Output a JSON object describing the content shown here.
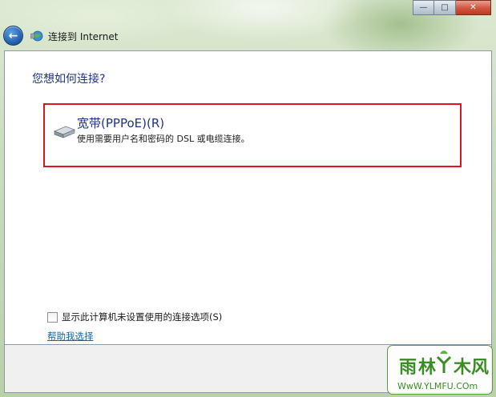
{
  "window": {
    "title": "连接到 Internet",
    "controls": {
      "minimize": "—",
      "maximize": "□",
      "close": "✕"
    }
  },
  "main": {
    "heading": "您想如何连接?",
    "options": [
      {
        "title": "宽带(PPPoE)(R)",
        "description": "使用需要用户名和密码的 DSL 或电缆连接。",
        "icon": "modem-icon",
        "highlight_color": "#d8181f"
      }
    ],
    "checkbox": {
      "label": "显示此计算机未设置使用的连接选项(S)",
      "checked": false
    },
    "help_link": "帮助我选择"
  },
  "icons": {
    "back": "back-arrow-icon",
    "network": "network-globe-icon"
  },
  "colors": {
    "heading": "#1e3287",
    "link": "#0a66b5",
    "highlight": "#d8181f",
    "watermark_green": "#3b8c26"
  }
}
